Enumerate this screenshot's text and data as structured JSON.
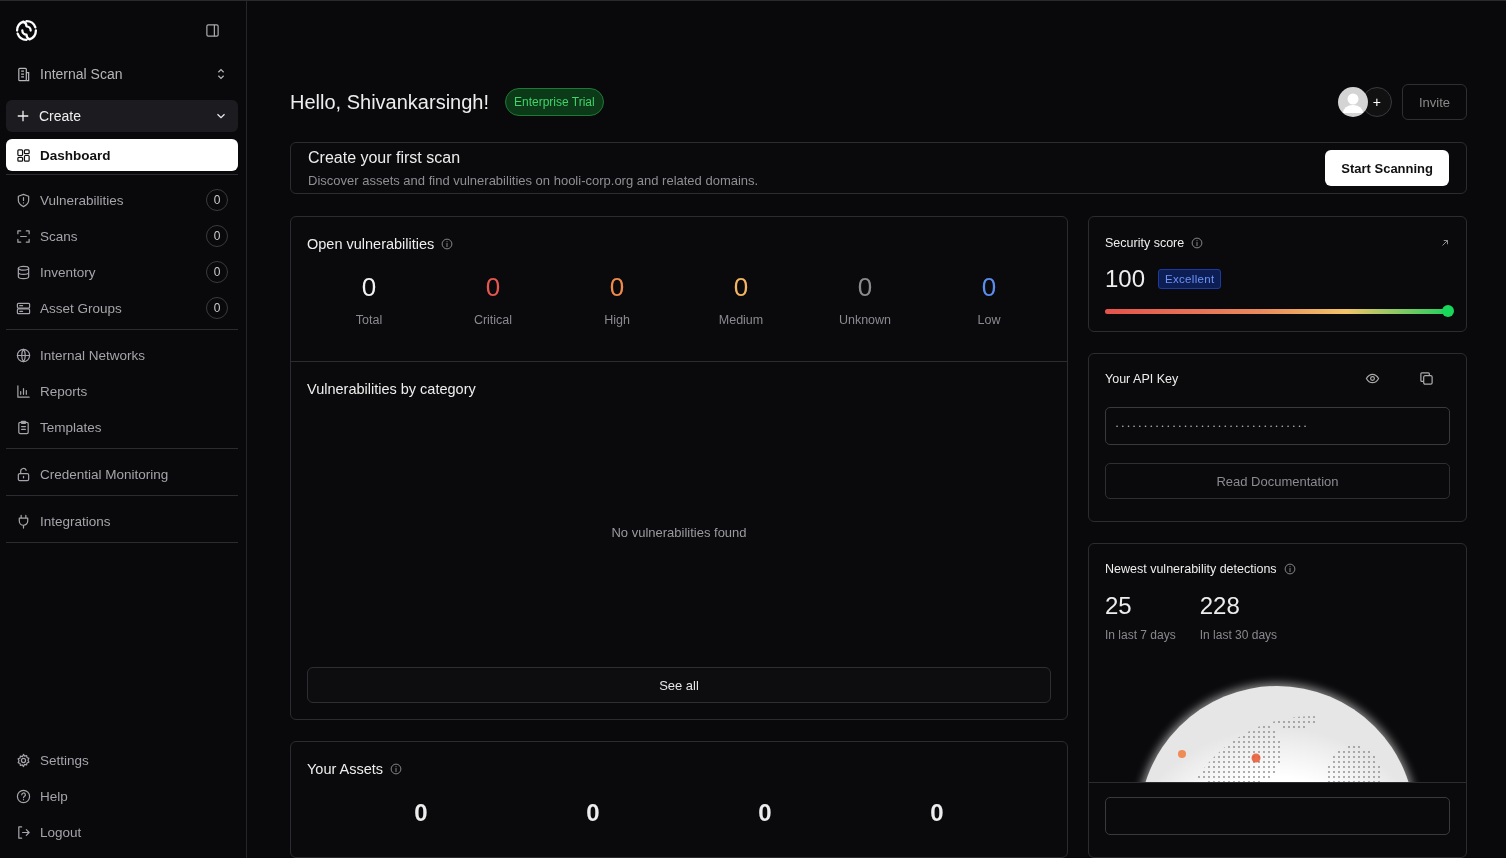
{
  "sidebar": {
    "workspace": "Internal Scan",
    "create_button": "Create",
    "groups": [
      {
        "items": [
          {
            "label": "Dashboard",
            "selected": true
          }
        ]
      },
      {
        "items": [
          {
            "label": "Vulnerabilities",
            "count": "0",
            "selected": false
          },
          {
            "label": "Scans",
            "count": "0",
            "selected": false
          },
          {
            "label": "Inventory",
            "count": "0",
            "selected": false
          },
          {
            "label": "Asset Groups",
            "count": "0",
            "selected": false
          }
        ]
      },
      {
        "items": [
          {
            "label": "Internal Networks",
            "selected": false
          },
          {
            "label": "Reports",
            "selected": false
          },
          {
            "label": "Templates",
            "selected": false
          }
        ]
      },
      {
        "items": [
          {
            "label": "Credential Monitoring",
            "selected": false
          }
        ]
      },
      {
        "items": [
          {
            "label": "Integrations",
            "selected": false
          }
        ]
      }
    ],
    "footer": [
      {
        "label": "Settings"
      },
      {
        "label": "Help"
      },
      {
        "label": "Logout"
      }
    ]
  },
  "header": {
    "greeting": "Hello, Shivankarsingh!",
    "plan_badge": "Enterprise Trial",
    "add_member_button": "+",
    "invite_button": "Invite"
  },
  "scan_banner": {
    "title": "Create your first scan",
    "description": "Discover assets and find vulnerabilities on hooli-corp.org and related domains.",
    "button": "Start Scanning"
  },
  "open_vulnerabilities": {
    "title": "Open vulnerabilities",
    "stats": [
      {
        "value": "0",
        "label": "Total",
        "color": "#f2f2f2"
      },
      {
        "value": "0",
        "label": "Critical",
        "color": "#e5574f"
      },
      {
        "value": "0",
        "label": "High",
        "color": "#f08a4b"
      },
      {
        "value": "0",
        "label": "Medium",
        "color": "#f3b562"
      },
      {
        "value": "0",
        "label": "Unknown",
        "color": "#8a8a8e"
      },
      {
        "value": "0",
        "label": "Low",
        "color": "#5b8def"
      }
    ]
  },
  "by_category": {
    "title": "Vulnerabilities by category",
    "empty_text": "No vulnerabilities found",
    "button": "See all"
  },
  "assets": {
    "title": "Your Assets",
    "values": [
      "0",
      "0",
      "0",
      "0"
    ]
  },
  "security_score": {
    "title": "Security score",
    "score": "100",
    "rating": "Excellent",
    "level": 1
  },
  "api_key": {
    "title": "Your API Key",
    "masked_value": "••••••••••••••••••••••••••••••••••",
    "button": "Read Documentation"
  },
  "detections": {
    "title": "Newest vulnerability detections",
    "stats": [
      {
        "value": "25",
        "label": "In last 7 days"
      },
      {
        "value": "228",
        "label": "In last 30 days"
      }
    ]
  }
}
